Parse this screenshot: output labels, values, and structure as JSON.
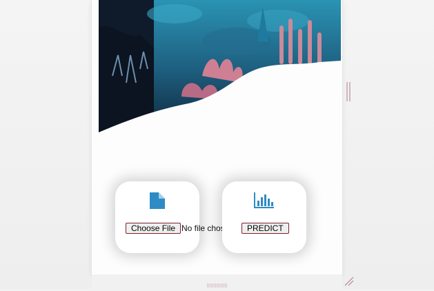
{
  "upload": {
    "button_label": "Choose File",
    "status_text": "No file chosen"
  },
  "predict": {
    "button_label": "PREDICT"
  },
  "icons": {
    "upload": "document-icon",
    "predict": "bar-chart-icon"
  },
  "colors": {
    "accent": "#2e8bc4",
    "button_border": "#7a1f2b"
  }
}
